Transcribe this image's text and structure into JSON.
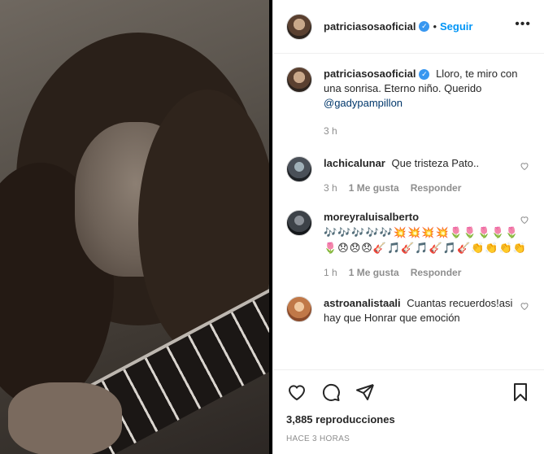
{
  "post": {
    "author": "patriciasosaoficial",
    "follow_label": "Seguir",
    "dot": "•",
    "more_label": "•••",
    "caption": {
      "username": "patriciasosaoficial",
      "text": "Lloro, te miro con una sonrisa. Eterno niño. Querido ",
      "mention": "@gadypampillon",
      "time": "3 h"
    },
    "comments": [
      {
        "username": "lachicalunar",
        "text": "Que tristeza Pato..",
        "time": "3 h",
        "likes": "1 Me gusta",
        "reply": "Responder"
      },
      {
        "username": "moreyraluisalberto",
        "text": "🎶🎶🎶🎶🎶💥💥💥💥🌷🌷🌷🌷🌷🌷😞😞😞🎸🎵🎸🎵🎸🎵🎸👏👏👏👏",
        "time": "1 h",
        "likes": "1 Me gusta",
        "reply": "Responder"
      },
      {
        "username": "astroanalistaali",
        "text": "Cuantas recuerdos!asi hay que Honrar que emoción",
        "time": "",
        "likes": "",
        "reply": ""
      }
    ],
    "views": "3,885 reproducciones",
    "posted_ago": "HACE 3 HORAS"
  },
  "icons": {
    "verified": "verified-badge-icon",
    "like": "heart-icon",
    "comment": "comment-icon",
    "share": "paper-plane-icon",
    "save": "bookmark-icon"
  },
  "colors": {
    "accent": "#0095f6",
    "verified": "#3897f0",
    "muted": "#8e8e8e",
    "mention": "#00376b"
  }
}
